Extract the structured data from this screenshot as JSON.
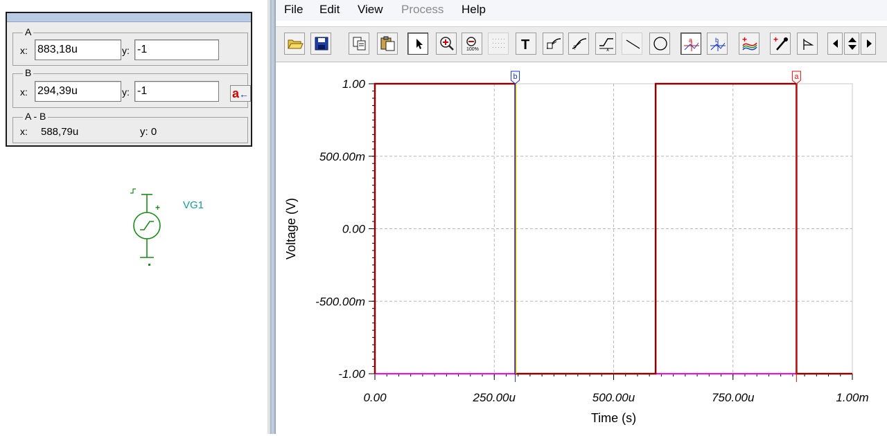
{
  "menu": {
    "file": "File",
    "edit": "Edit",
    "view": "View",
    "process": "Process",
    "help": "Help"
  },
  "cursor_panel": {
    "a": {
      "title": "A",
      "x_label": "x:",
      "x_value": "883,18u",
      "y_label": "y:",
      "y_value": "-1"
    },
    "b": {
      "title": "B",
      "x_label": "x:",
      "x_value": "294,39u",
      "y_label": "y:",
      "y_value": "-1",
      "swap_label": "a"
    },
    "diff": {
      "title": "A - B",
      "x_label": "x:",
      "x_value": "588,79u",
      "y_label": "y: 0"
    }
  },
  "schematic": {
    "generator_label": "VG1",
    "plus_sign": "+"
  },
  "toolbar": {
    "icons": [
      "open-icon",
      "save-icon",
      "copy-icon",
      "paste-icon",
      "pointer-icon",
      "zoom-in-icon",
      "zoom-out-icon",
      "grid-icon",
      "text-icon",
      "label-curve-icon",
      "label-point-icon",
      "label-x-icon",
      "line-icon",
      "circle-icon",
      "cursor-a-icon",
      "cursor-b-icon",
      "add-curve-icon",
      "color-picker-icon",
      "marker-icon",
      "scroll-left-icon",
      "scroll-updown-icon",
      "scroll-right-icon"
    ]
  },
  "chart_data": {
    "type": "line",
    "xlabel": "Time (s)",
    "ylabel": "Voltage (V)",
    "xlim": [
      0,
      0.001
    ],
    "ylim": [
      -1,
      1
    ],
    "xticks": [
      "0.00",
      "250.00u",
      "500.00u",
      "750.00u",
      "1.00m"
    ],
    "yticks": [
      "1.00",
      "500.00m",
      "0.00",
      "-500.00m",
      "-1.00"
    ],
    "grid": true,
    "series": [
      {
        "color": "#8b0000",
        "x": [
          0,
          0,
          0.000294,
          0.000294,
          0.000588,
          0.000588,
          0.000883,
          0.000883,
          0.001
        ],
        "y": [
          -1,
          1,
          1,
          -1,
          -1,
          1,
          1,
          -1,
          -1
        ]
      },
      {
        "color": "#ff00ff",
        "x": [
          0,
          0.001
        ],
        "y": [
          -1,
          -1
        ]
      }
    ],
    "cursors": [
      {
        "label": "b",
        "x": 0.000294,
        "color": "#1a32d0"
      },
      {
        "label": "a",
        "x": 0.000883,
        "color": "#e01010"
      }
    ]
  }
}
